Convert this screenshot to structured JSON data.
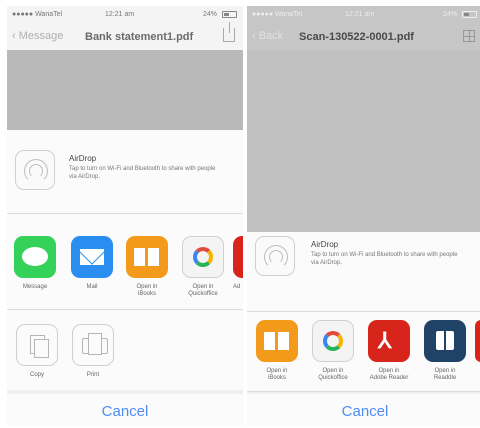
{
  "left": {
    "status": {
      "carrier": "●●●●● WanaTel ",
      "time": "12:21 am",
      "battery": "24%"
    },
    "nav": {
      "back": "‹ Message",
      "title": "Bank statement1.pdf"
    },
    "airdrop": {
      "title": "AirDrop",
      "text": "Tap to turn on Wi-Fi and Bluetooth to share with people via AirDrop."
    },
    "apps": [
      {
        "label": "Message",
        "icon": "messages-icon"
      },
      {
        "label": "Mail",
        "icon": "mail-icon"
      },
      {
        "label": "Open in\niBooks",
        "icon": "ibooks-icon"
      },
      {
        "label": "Open in\nQuickoffice",
        "icon": "quickoffice-icon"
      },
      {
        "label": "Ad",
        "icon": "adobe-icon"
      }
    ],
    "actions": [
      {
        "label": "Copy",
        "icon": "copy-icon"
      },
      {
        "label": "Print",
        "icon": "print-icon"
      }
    ],
    "cancel": "Cancel"
  },
  "right": {
    "status": {
      "carrier": "●●●●● WanaTel ",
      "time": "12:21 am",
      "battery": "24%"
    },
    "nav": {
      "back": "‹ Back",
      "title": "Scan-130522-0001.pdf"
    },
    "airdrop": {
      "title": "AirDrop",
      "text": "Tap to turn on Wi-Fi and Bluetooth to share with people via AirDrop."
    },
    "apps": [
      {
        "label": "Open in\niBooks",
        "icon": "ibooks-icon"
      },
      {
        "label": "Open in\nQuickoffice",
        "icon": "quickoffice-icon"
      },
      {
        "label": "Open in\nAdobe Reader",
        "icon": "adobe-reader-icon"
      },
      {
        "label": "Open in\nReaddle",
        "icon": "readdle-icon"
      }
    ],
    "cancel": "Cancel"
  },
  "colors": {
    "accent": "#4f8cf3",
    "messages": "#35d25a",
    "mail": "#2a8ef0",
    "ibooks": "#f39a1a",
    "adobe": "#d8251c",
    "readdle": "#1f4267"
  }
}
